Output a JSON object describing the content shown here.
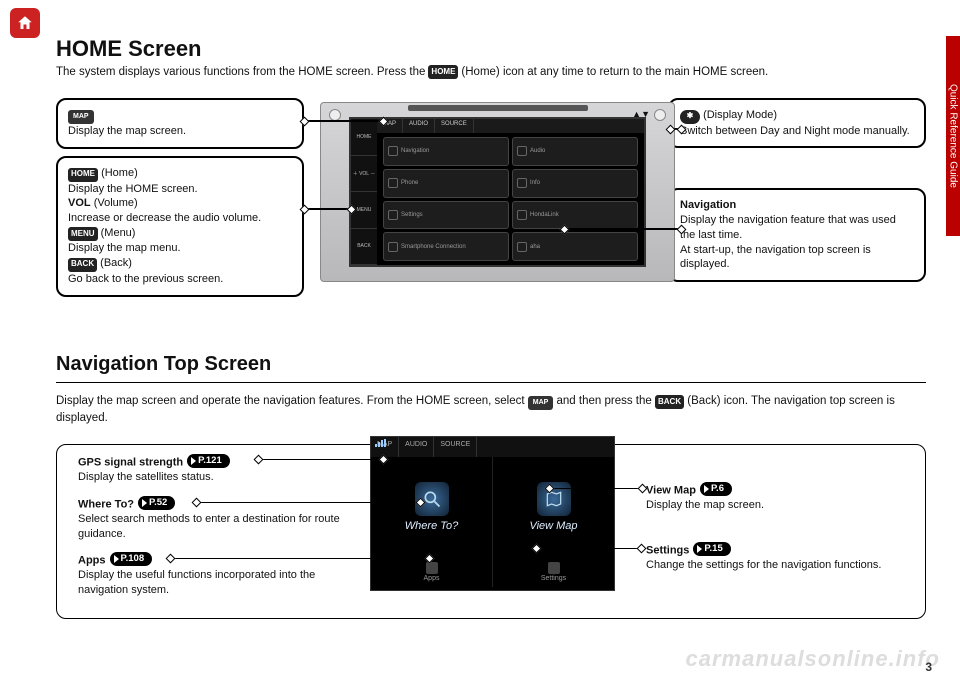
{
  "topnav": {
    "home_tooltip": "Home"
  },
  "sidetab": "Quick Reference Guide",
  "h1": "HOME Screen",
  "intro_a": "The system displays various functions from the HOME screen. Press the",
  "intro_home_icon": "HOME",
  "intro_b": "(Home) icon at any time to return to the main HOME screen.",
  "callouts": {
    "map": {
      "icon": "MAP",
      "text": "Display the map screen."
    },
    "left": {
      "home_icon": "HOME",
      "home_lbl": "(Home)",
      "home_txt": "Display the HOME screen.",
      "vol_lbl": "VOL",
      "vol_par": "(Volume)",
      "vol_txt": "Increase or decrease the audio volume.",
      "menu_icon": "MENU",
      "menu_lbl": "(Menu)",
      "menu_txt": "Display the map menu.",
      "back_icon": "BACK",
      "back_lbl": "(Back)",
      "back_txt": "Go back to the previous screen."
    },
    "dm": {
      "icon": "✱",
      "lbl": "(Display Mode)",
      "txt": "Switch between Day and Night mode manually."
    },
    "nav": {
      "title": "Navigation",
      "l1": "Display the navigation feature that was used the last time.",
      "l2": "At start-up, the navigation top screen is displayed."
    }
  },
  "device": {
    "side": [
      "HOME",
      "＋ VOL －",
      "MENU",
      "BACK"
    ],
    "tabs": [
      "MAP",
      "AUDIO",
      "SOURCE"
    ],
    "tiles": [
      "Navigation",
      "Audio",
      "Phone",
      "Info",
      "Settings",
      "HondaLink",
      "Smartphone Connection",
      "aha"
    ]
  },
  "h2": "Navigation Top Screen",
  "desc2_a": "Display the map screen and operate the navigation features. From the HOME screen, select",
  "desc2_map": "MAP",
  "desc2_b": "and then press the",
  "desc2_back": "BACK",
  "desc2_c": "(Back) icon. The navigation top screen is displayed.",
  "nav2": {
    "tabs": [
      "MAP",
      "AUDIO",
      "SOURCE"
    ],
    "big": [
      "Where To?",
      "View Map"
    ],
    "foot": [
      "Apps",
      "Settings"
    ]
  },
  "items": {
    "gps": {
      "t": "GPS signal strength",
      "p": "P.121",
      "d": "Display the satellites status."
    },
    "where": {
      "t": "Where To?",
      "p": "P.52",
      "d": "Select search methods to enter a destination for route guidance."
    },
    "apps": {
      "t": "Apps",
      "p": "P.108",
      "d": "Display the useful functions incorporated into the navigation system."
    },
    "view": {
      "t": "View Map",
      "p": "P.6",
      "d": "Display the map screen."
    },
    "set": {
      "t": "Settings",
      "p": "P.15",
      "d": "Change the settings for the navigation functions."
    }
  },
  "watermark": "carmanualsonline.info",
  "page": "3"
}
